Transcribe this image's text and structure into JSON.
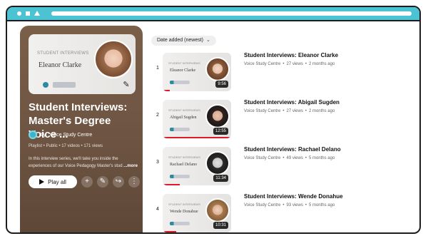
{
  "playlist": {
    "thumbnail": {
      "label": "STUDENT INTERVIEWS",
      "name": "Eleanor Clarke"
    },
    "title": "Student Interviews:\nMaster's Degree Voice ...",
    "channel": {
      "prefix": "by",
      "name": "Voice Study Centre"
    },
    "meta": "Playlist • Public • 17 videos • 171 views",
    "description": "In this interview series, we'll take you inside the experiences of our Voice Pedagogy Master's stud",
    "description_more": "...more",
    "actions": {
      "play_all": "Play all",
      "icons": [
        "plus-icon",
        "pencil-icon",
        "share-icon",
        "more-icon"
      ]
    }
  },
  "sort": {
    "label": "Date added (newest)",
    "icon": "chevron-down-icon"
  },
  "videos": [
    {
      "index": "1",
      "title": "Student Interviews: Eleanor Clarke",
      "channel": "Voice Study Centre",
      "views": "27 views",
      "age": "2 months ago",
      "duration": "9:56",
      "thumb_name": "Eleanor Clarke",
      "thumb_label": "STUDENT INTERVIEWS",
      "watched_fraction": 0.1
    },
    {
      "index": "2",
      "title": "Student Interviews: Abigail Sugden",
      "channel": "Voice Study Centre",
      "views": "27 views",
      "age": "2 months ago",
      "duration": "12:55",
      "thumb_name": "Abigail Sugden",
      "thumb_label": "STUDENT INTERVIEWS",
      "watched_fraction": 1.0
    },
    {
      "index": "3",
      "title": "Student Interviews: Rachael Delano",
      "channel": "Voice Study Centre",
      "views": "49 views",
      "age": "5 months ago",
      "duration": "11:34",
      "thumb_name": "Rachael Delano",
      "thumb_label": "STUDENT INTERVIEWS",
      "watched_fraction": 0.25
    },
    {
      "index": "4",
      "title": "Student Interviews: Wende Donahue",
      "channel": "Voice Study Centre",
      "views": "93 views",
      "age": "5 months ago",
      "duration": "10:31",
      "thumb_name": "Wende Donahue",
      "thumb_label": "STUDENT INTERVIEWS",
      "watched_fraction": 0.2
    }
  ],
  "colors": {
    "accent_cyan": "#4cc3d3",
    "panel_brown": "#6d5442",
    "progress_red": "#e0182c"
  }
}
